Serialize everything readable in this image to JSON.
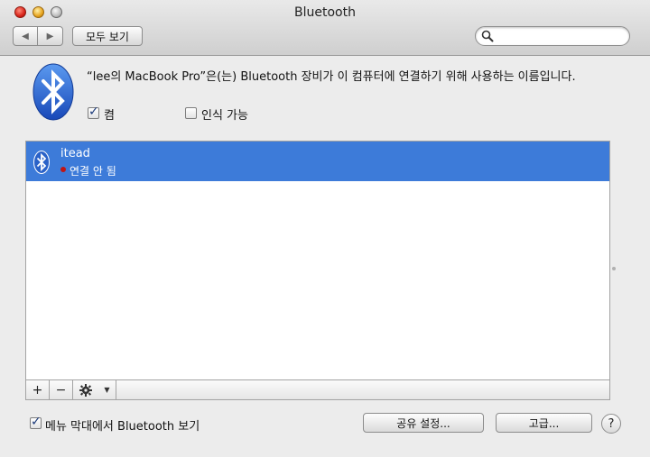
{
  "window": {
    "title": "Bluetooth"
  },
  "toolbar": {
    "back_label": "◀",
    "forward_label": "▶",
    "show_all_label": "모두 보기",
    "search_placeholder": ""
  },
  "header": {
    "description": "“lee의 MacBook Pro”은(는) Bluetooth 장비가 이 컴퓨터에 연결하기 위해 사용하는 이름입니다.",
    "on_label": "켬",
    "on_checked": true,
    "discoverable_label": "인식 가능",
    "discoverable_checked": false
  },
  "devices": [
    {
      "name": "itead",
      "status": "연결 안 됨",
      "status_color": "#c01515",
      "selected": true
    }
  ],
  "list_toolbar": {
    "add_label": "+",
    "remove_label": "−",
    "action_icon": "gear-icon",
    "menu_arrow": "▼"
  },
  "footer": {
    "menu_bar_label": "메뉴 막대에서 Bluetooth 보기",
    "menu_bar_checked": true,
    "sharing_button": "공유 설정...",
    "advanced_button": "고급...",
    "help_label": "?"
  },
  "colors": {
    "selection": "#3d7bd9",
    "bluetooth_blue": "#1f5fd0"
  }
}
